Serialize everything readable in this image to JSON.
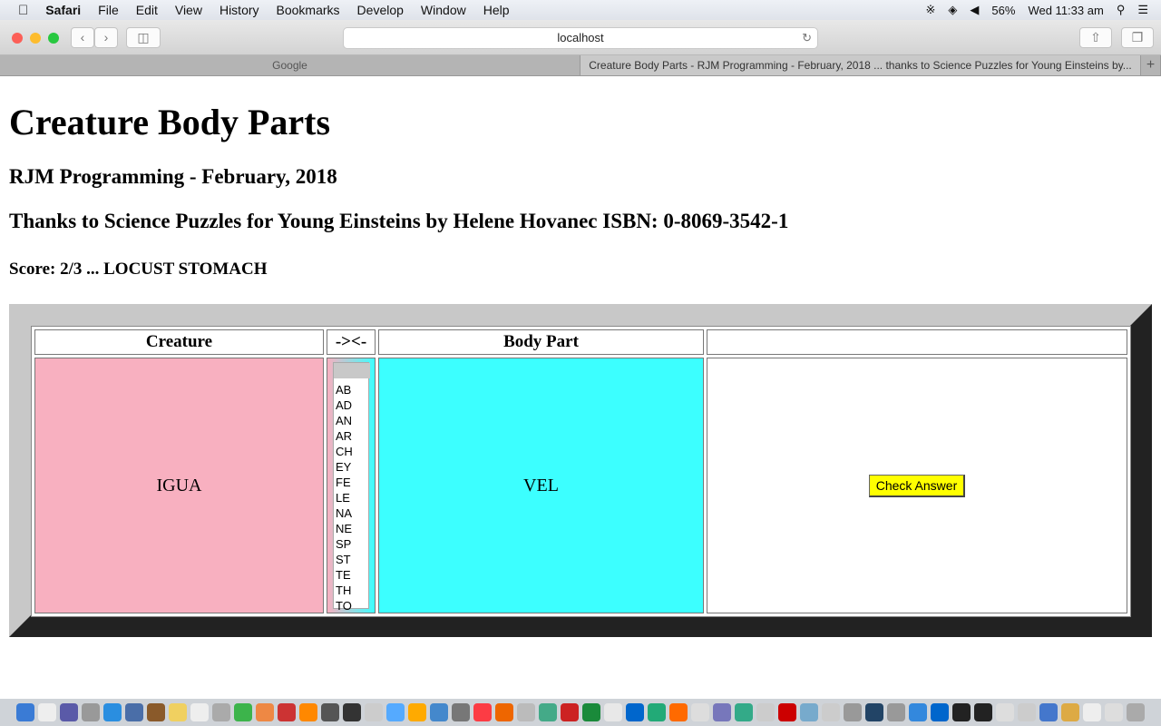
{
  "menubar": {
    "apple": "",
    "items": [
      "Safari",
      "File",
      "Edit",
      "View",
      "History",
      "Bookmarks",
      "Develop",
      "Window",
      "Help"
    ],
    "battery": "56%",
    "clock": "Wed 11:33 am"
  },
  "browser": {
    "url": "localhost",
    "tabs": [
      {
        "label": "Google",
        "active": false
      },
      {
        "label": "Creature Body Parts - RJM Programming - February, 2018 ... thanks to Science Puzzles for Young Einsteins by...",
        "active": true
      }
    ],
    "new_tab": "+"
  },
  "page": {
    "title": "Creature Body Parts",
    "subtitle": "RJM Programming - February, 2018",
    "credit": "Thanks to Science Puzzles for Young Einsteins by Helene Hovanec ISBN: 0-8069-3542-1",
    "score": "Score: 2/3 ... LOCUST STOMACH"
  },
  "table": {
    "headers": [
      "Creature",
      "-><-",
      "Body Part",
      ""
    ],
    "creature": "IGUA",
    "body_part": "VEL",
    "options": [
      "",
      "AB",
      "AD",
      "AN",
      "AR",
      "CH",
      "EY",
      "FE",
      "LE",
      "NA",
      "NE",
      "SP",
      "ST",
      "TE",
      "TH",
      "TO"
    ],
    "check_label": "Check Answer",
    "colors": {
      "creature": "#f8b0c0",
      "body": "#3cffff",
      "button": "#ffff00"
    }
  },
  "dock": {
    "colors": [
      "#3a7bd5",
      "#eee",
      "#5a5aa8",
      "#999",
      "#2a8ee0",
      "#4a6ea8",
      "#8a5a2a",
      "#f0d060",
      "#eee",
      "#aaa",
      "#3cb44b",
      "#e84",
      "#c33",
      "#f80",
      "#555",
      "#333",
      "#ccc",
      "#5af",
      "#fa0",
      "#48c",
      "#777",
      "#fc3c44",
      "#e60",
      "#bbb",
      "#4a8",
      "#c22",
      "#1a8a3a",
      "#e8e8e8",
      "#06c",
      "#2a7",
      "#ff6a00",
      "#ddd",
      "#77b",
      "#3a8",
      "#ccc",
      "#c00",
      "#7ac",
      "#ccc",
      "#999",
      "#246",
      "#999",
      "#38d",
      "#06c",
      "#222",
      "#222",
      "#ddd",
      "#ccc",
      "#47c",
      "#da4",
      "#eee",
      "#ddd",
      "#aaa"
    ]
  }
}
